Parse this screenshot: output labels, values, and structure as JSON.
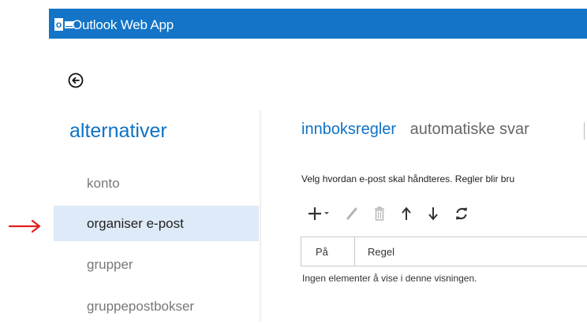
{
  "header": {
    "app_title": "Outlook Web App",
    "bar_color": "#1374c8",
    "logo_letter": "o"
  },
  "back_button": {
    "icon": "back-arrow-circle-icon"
  },
  "sidebar": {
    "title": "alternativer",
    "items": [
      {
        "label": "konto",
        "selected": false
      },
      {
        "label": "organiser e-post",
        "selected": true
      },
      {
        "label": "grupper",
        "selected": false
      },
      {
        "label": "gruppepostbokser",
        "selected": false
      }
    ]
  },
  "annotation": {
    "arrow_color": "#e02020"
  },
  "tabs": [
    {
      "label": "innboksregler",
      "active": true
    },
    {
      "label": "automatiske svar",
      "active": false
    }
  ],
  "description": "Velg hvordan e-post skal håndteres. Regler blir bru",
  "toolbar": [
    "add-icon",
    "edit-icon",
    "delete-icon",
    "move-up-icon",
    "move-down-icon",
    "refresh-icon"
  ],
  "table": {
    "columns": [
      "På",
      "Regel"
    ],
    "empty_message": "Ingen elementer å vise i denne visningen."
  },
  "colors": {
    "accent": "#0f72c6",
    "selected_bg": "#deeaf7"
  }
}
